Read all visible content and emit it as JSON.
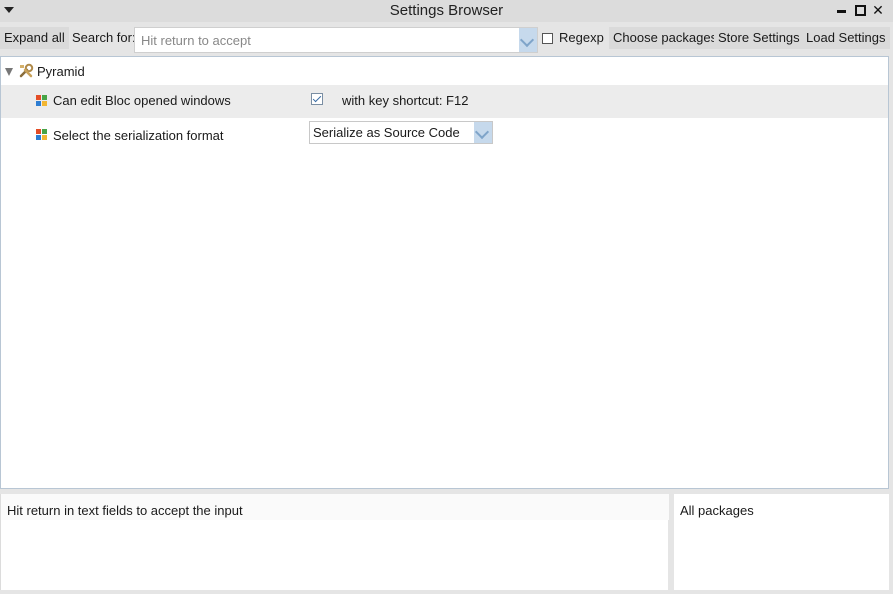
{
  "window": {
    "title": "Settings Browser"
  },
  "toolbar": {
    "expand_all_label": "Expand all",
    "search_label": "Search for:",
    "search_placeholder": "Hit return to accept",
    "search_value": "",
    "regexp_label": "Regexp",
    "regexp_checked": false,
    "choose_packages_label": "Choose packages",
    "store_settings_label": "Store Settings",
    "load_settings_label": "Load Settings"
  },
  "tree": {
    "group_label": "Pyramid",
    "items": [
      {
        "label": "Can edit Bloc opened windows",
        "checked": true,
        "extra_label": "with key shortcut: F12"
      },
      {
        "label": "Select the serialization format",
        "selected_option": "Serialize as Source Code"
      }
    ]
  },
  "bottom": {
    "hint_text": "Hit return in text fields to accept the input",
    "packages_label": "All packages"
  },
  "colors": {
    "accent": "#c6d9ec",
    "selected_row": "#ececec",
    "panel_border": "#b8c6d4"
  }
}
